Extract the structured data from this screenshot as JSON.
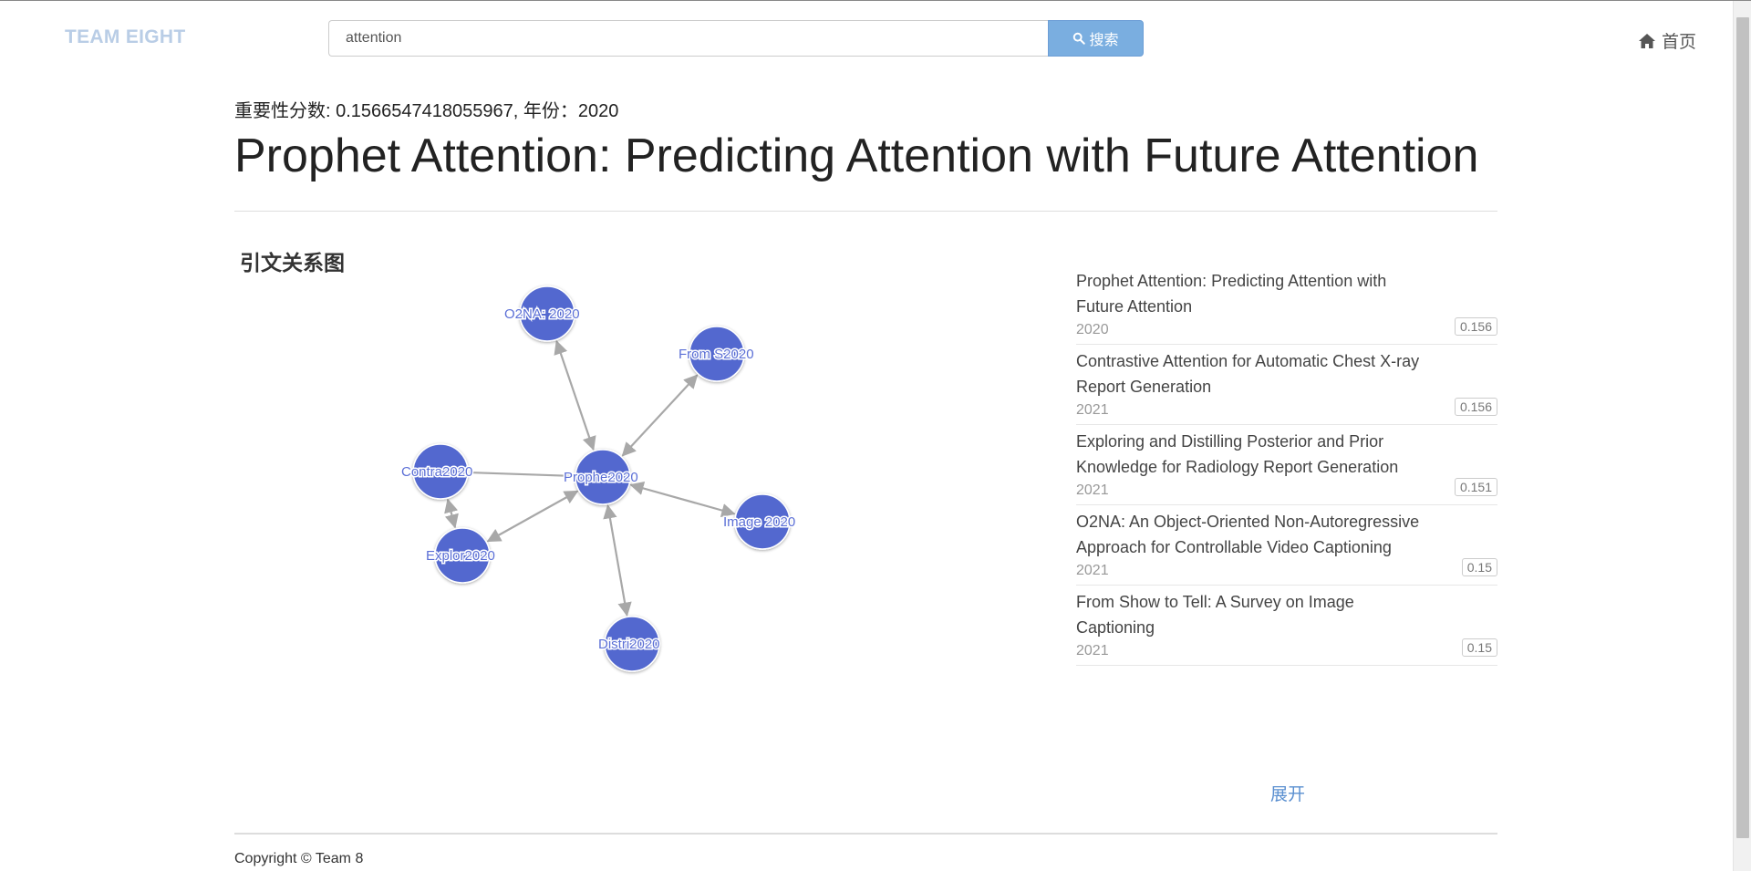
{
  "header": {
    "brand": "TEAM EIGHT",
    "search_value": "attention",
    "search_button": "搜索",
    "home_label": "首页"
  },
  "paper": {
    "meta": "重要性分数: 0.1566547418055967, 年份：2020",
    "title": "Prophet Attention: Predicting Attention with Future Attention"
  },
  "graph": {
    "section_title": "引文关系图",
    "node_color": "#5268cf",
    "edge_color": "#a8a8a8",
    "nodes": [
      {
        "id": "o2na",
        "label": "O2NA: 2020"
      },
      {
        "id": "froms",
        "label": "From S2020"
      },
      {
        "id": "contra",
        "label": "Contra2020"
      },
      {
        "id": "prophe",
        "label": "Prophe2020"
      },
      {
        "id": "image",
        "label": "Image 2020"
      },
      {
        "id": "explor",
        "label": "Explor2020"
      },
      {
        "id": "distri",
        "label": "Distri2020"
      }
    ]
  },
  "citations": [
    {
      "title": "Prophet Attention: Predicting Attention with Future Attention",
      "year": "2020",
      "score": "0.156"
    },
    {
      "title": "Contrastive Attention for Automatic Chest X-ray Report Generation",
      "year": "2021",
      "score": "0.156"
    },
    {
      "title": "Exploring and Distilling Posterior and Prior Knowledge for Radiology Report Generation",
      "year": "2021",
      "score": "0.151"
    },
    {
      "title": "O2NA: An Object-Oriented Non-Autoregressive Approach for Controllable Video Captioning",
      "year": "2021",
      "score": "0.15"
    },
    {
      "title": "From Show to Tell: A Survey on Image Captioning",
      "year": "2021",
      "score": "0.15"
    }
  ],
  "expand_label": "展开",
  "footer": {
    "copyright": "Copyright © Team 8"
  }
}
